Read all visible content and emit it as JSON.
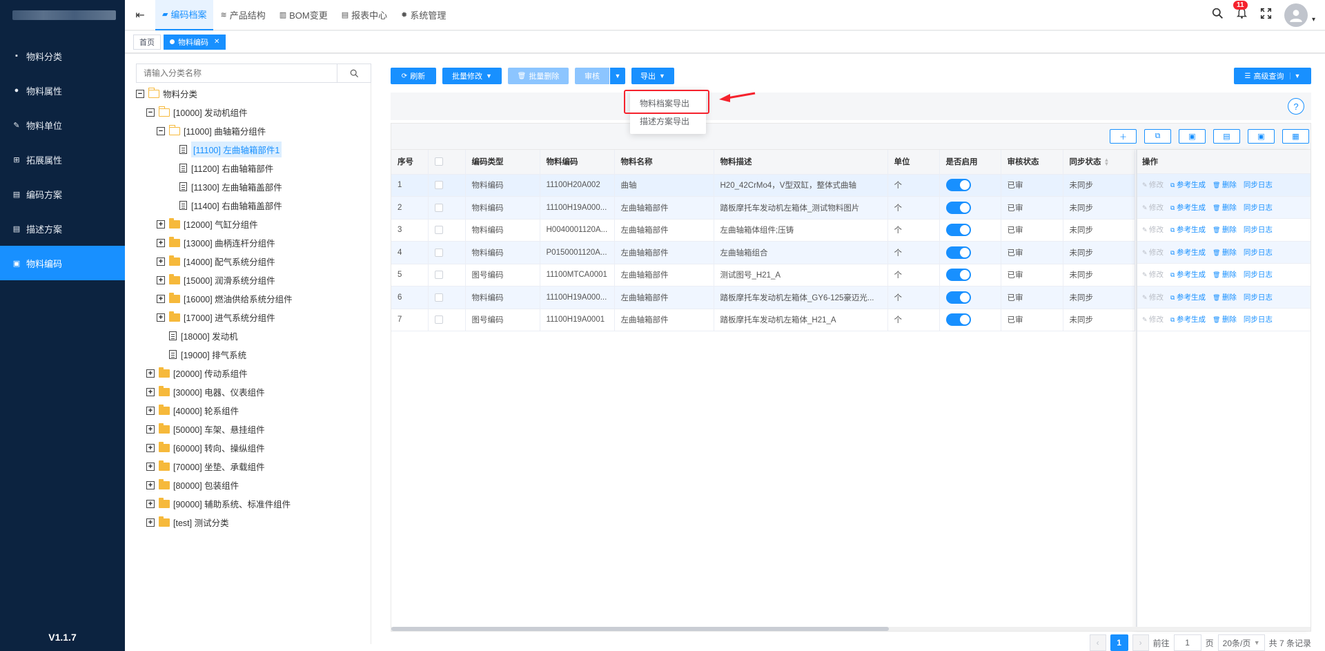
{
  "sidebar": {
    "items": [
      {
        "icon": "grid-icon",
        "glyph": "▪",
        "label": "物料分类"
      },
      {
        "icon": "info-icon",
        "glyph": "●",
        "label": "物料属性"
      },
      {
        "icon": "wrench-icon",
        "glyph": "✎",
        "label": "物料单位"
      },
      {
        "icon": "extend-icon",
        "glyph": "⊞",
        "label": "拓展属性"
      },
      {
        "icon": "doc-icon",
        "glyph": "▤",
        "label": "编码方案"
      },
      {
        "icon": "desc-icon",
        "glyph": "▤",
        "label": "描述方案"
      },
      {
        "icon": "code-icon",
        "glyph": "▣",
        "label": "物料编码"
      }
    ],
    "active_index": 6,
    "version": "V1.1.7"
  },
  "topnav": {
    "items": [
      {
        "icon": "folder-icon",
        "glyph": "▰",
        "label": "编码档案"
      },
      {
        "icon": "layers-icon",
        "glyph": "≋",
        "label": "产品结构"
      },
      {
        "icon": "bom-icon",
        "glyph": "▥",
        "label": "BOM变更"
      },
      {
        "icon": "report-icon",
        "glyph": "▤",
        "label": "报表中心"
      },
      {
        "icon": "gear-icon",
        "glyph": "✹",
        "label": "系统管理"
      }
    ],
    "notification_count": "11"
  },
  "tabs": [
    {
      "label": "首页"
    },
    {
      "label": "物料编码"
    }
  ],
  "tree": {
    "search_placeholder": "请输入分类名称",
    "nodes": [
      {
        "level": 0,
        "toggle": "minus",
        "icon": "folder-open",
        "label": "物料分类"
      },
      {
        "level": 1,
        "toggle": "minus",
        "icon": "folder-open",
        "label": "[10000] 发动机组件"
      },
      {
        "level": 2,
        "toggle": "minus",
        "icon": "folder-open",
        "label": "[11000] 曲轴箱分组件"
      },
      {
        "level": 3,
        "toggle": "none",
        "icon": "doc",
        "label": "[11100] 左曲轴箱部件1",
        "selected": true
      },
      {
        "level": 3,
        "toggle": "none",
        "icon": "doc",
        "label": "[11200] 右曲轴箱部件"
      },
      {
        "level": 3,
        "toggle": "none",
        "icon": "doc",
        "label": "[11300] 左曲轴箱盖部件"
      },
      {
        "level": 3,
        "toggle": "none",
        "icon": "doc",
        "label": "[11400] 右曲轴箱盖部件"
      },
      {
        "level": 2,
        "toggle": "plus",
        "icon": "folder",
        "label": "[12000] 气缸分组件"
      },
      {
        "level": 2,
        "toggle": "plus",
        "icon": "folder",
        "label": "[13000] 曲柄连杆分组件"
      },
      {
        "level": 2,
        "toggle": "plus",
        "icon": "folder",
        "label": "[14000] 配气系统分组件"
      },
      {
        "level": 2,
        "toggle": "plus",
        "icon": "folder",
        "label": "[15000] 润滑系统分组件"
      },
      {
        "level": 2,
        "toggle": "plus",
        "icon": "folder",
        "label": "[16000] 燃油供给系统分组件"
      },
      {
        "level": 2,
        "toggle": "plus",
        "icon": "folder",
        "label": "[17000] 进气系统分组件"
      },
      {
        "level": 2,
        "toggle": "none",
        "icon": "doc",
        "label": "[18000] 发动机"
      },
      {
        "level": 2,
        "toggle": "none",
        "icon": "doc",
        "label": "[19000] 排气系统"
      },
      {
        "level": 1,
        "toggle": "plus",
        "icon": "folder",
        "label": "[20000] 传动系组件"
      },
      {
        "level": 1,
        "toggle": "plus",
        "icon": "folder",
        "label": "[30000] 电器、仪表组件"
      },
      {
        "level": 1,
        "toggle": "plus",
        "icon": "folder",
        "label": "[40000] 轮系组件"
      },
      {
        "level": 1,
        "toggle": "plus",
        "icon": "folder",
        "label": "[50000] 车架、悬挂组件"
      },
      {
        "level": 1,
        "toggle": "plus",
        "icon": "folder",
        "label": "[60000] 转向、操纵组件"
      },
      {
        "level": 1,
        "toggle": "plus",
        "icon": "folder",
        "label": "[70000] 坐垫、承载组件"
      },
      {
        "level": 1,
        "toggle": "plus",
        "icon": "folder",
        "label": "[80000] 包装组件"
      },
      {
        "level": 1,
        "toggle": "plus",
        "icon": "folder",
        "label": "[90000] 辅助系统、标准件组件"
      },
      {
        "level": 1,
        "toggle": "plus",
        "icon": "folder",
        "label": "[test] 测试分类"
      }
    ]
  },
  "toolbar": {
    "refresh": "刷新",
    "batch_edit": "批量修改",
    "batch_delete": "批量删除",
    "audit": "审核",
    "export": "导出",
    "advanced_search": "高级查询"
  },
  "export_menu": [
    "物料档案导出",
    "描述方案导出"
  ],
  "help": "?",
  "table": {
    "columns": [
      "序号",
      "",
      "编码类型",
      "物料编码",
      "物料名称",
      "物料描述",
      "单位",
      "是否启用",
      "审核状态",
      "同步状态"
    ],
    "op_header": "操作",
    "rows": [
      {
        "no": "1",
        "type": "物料编码",
        "code": "11100H20A002",
        "name": "曲轴",
        "desc": "H20_42CrMo4，V型双缸，整体式曲轴",
        "unit": "个",
        "status": "已审",
        "sync": "未同步"
      },
      {
        "no": "2",
        "type": "物料编码",
        "code": "11100H19A000...",
        "name": "左曲轴箱部件",
        "desc": "踏板摩托车发动机左箱体_测试物料图片",
        "unit": "个",
        "status": "已审",
        "sync": "未同步"
      },
      {
        "no": "3",
        "type": "物料编码",
        "code": "H0040001120A...",
        "name": "左曲轴箱部件",
        "desc": "左曲轴箱体组件;压铸",
        "unit": "个",
        "status": "已审",
        "sync": "未同步"
      },
      {
        "no": "4",
        "type": "物料编码",
        "code": "P0150001120A...",
        "name": "左曲轴箱部件",
        "desc": "左曲轴箱组合",
        "unit": "个",
        "status": "已审",
        "sync": "未同步"
      },
      {
        "no": "5",
        "type": "图号编码",
        "code": "11100MTCA0001",
        "name": "左曲轴箱部件",
        "desc": "测试图号_H21_A",
        "unit": "个",
        "status": "已审",
        "sync": "未同步"
      },
      {
        "no": "6",
        "type": "物料编码",
        "code": "11100H19A000...",
        "name": "左曲轴箱部件",
        "desc": "踏板摩托车发动机左箱体_GY6-125豪迈光...",
        "unit": "个",
        "status": "已审",
        "sync": "未同步"
      },
      {
        "no": "7",
        "type": "图号编码",
        "code": "11100H19A0001",
        "name": "左曲轴箱部件",
        "desc": "踏板摩托车发动机左箱体_H21_A",
        "unit": "个",
        "status": "已审",
        "sync": "未同步"
      }
    ],
    "ops": {
      "edit": "修改",
      "ref": "参考生成",
      "del": "删除",
      "log": "同步日志"
    }
  },
  "pager": {
    "page": "1",
    "goto_label": "前往",
    "goto_value": "1",
    "page_unit": "页",
    "page_size": "20条/页",
    "total": "共 7 条记录"
  }
}
